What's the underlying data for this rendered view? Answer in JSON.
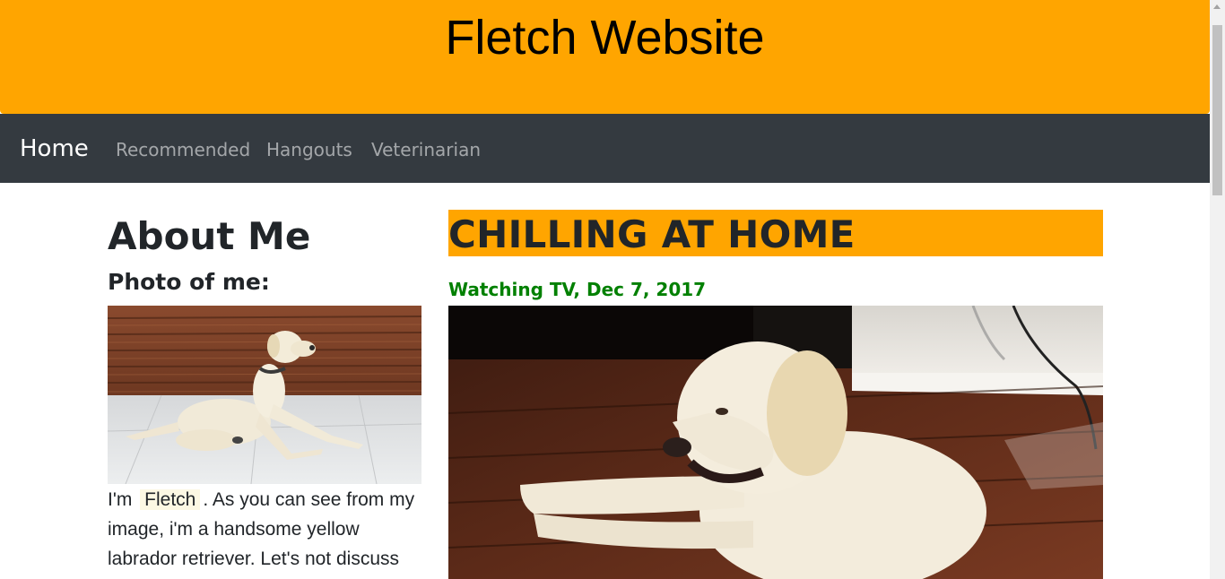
{
  "header": {
    "title": "Fletch Website"
  },
  "nav": {
    "brand": "Home",
    "links": [
      "Recommended",
      "Hangouts",
      "Veterinarian"
    ]
  },
  "about": {
    "title": "About Me",
    "photo_label": "Photo of me:",
    "bio_before": "I'm ",
    "bio_name": "Fletch",
    "bio_after": ". As you can see from my image, i'm a handsome yellow labrador retriever. Let's not discuss"
  },
  "post": {
    "title": "CHILLING AT HOME",
    "subtitle": "Watching TV, Dec 7, 2017"
  },
  "colors": {
    "hero_bg": "#ffa500",
    "navbar_bg": "#343a40",
    "subtitle_green": "#008000"
  },
  "icons": {
    "scroll_up": "scroll-up-arrow-icon"
  }
}
